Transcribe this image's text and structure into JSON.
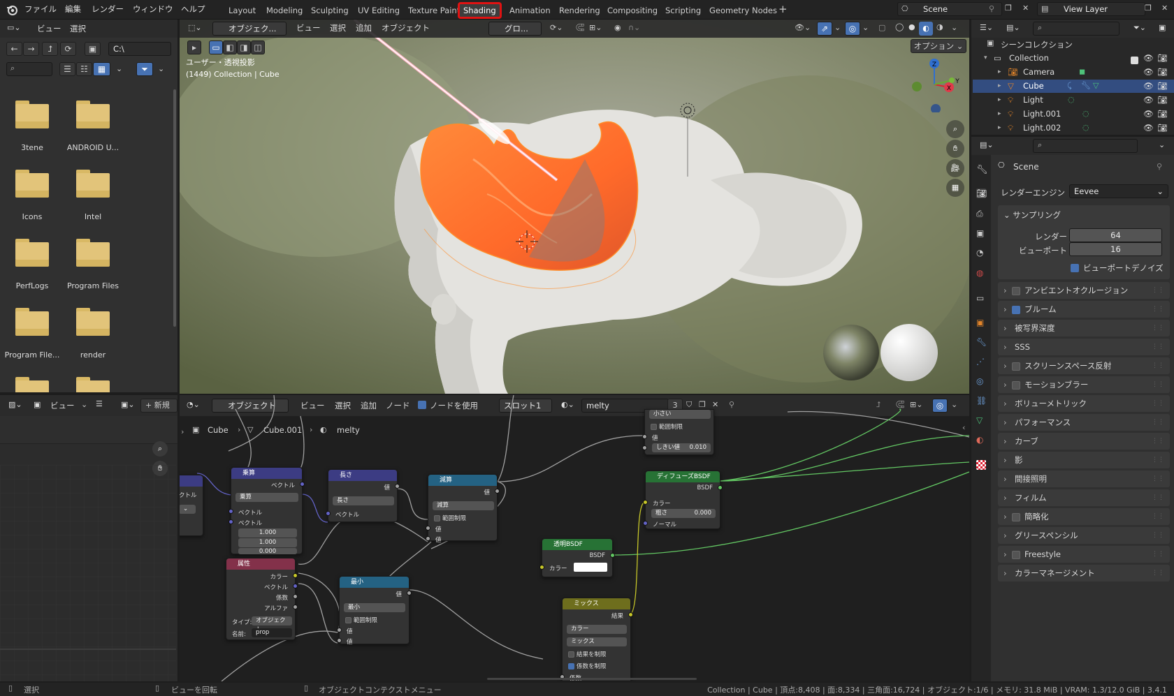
{
  "topbar": {
    "menus": [
      "ファイル",
      "編集",
      "レンダー",
      "ウィンドウ",
      "ヘルプ"
    ],
    "workspaces": [
      "Layout",
      "Modeling",
      "Sculpting",
      "UV Editing",
      "Texture Paint",
      "Shading",
      "Animation",
      "Rendering",
      "Compositing",
      "Scripting",
      "Geometry Nodes"
    ],
    "active_workspace": "Shading",
    "scene_name": "Scene",
    "view_layer": "View Layer"
  },
  "file_browser": {
    "header": {
      "view": "ビュー",
      "select": "選択"
    },
    "path": "C:\\",
    "folders": [
      "3tene",
      "ANDROID U...",
      "Icons",
      "Intel",
      "PerfLogs",
      "Program Files",
      "Program File...",
      "render"
    ]
  },
  "viewport": {
    "header": {
      "mode": "オブジェク...",
      "view": "ビュー",
      "select": "選択",
      "add": "追加",
      "object": "オブジェクト",
      "transform": "グロ..."
    },
    "options": "オプション",
    "info_line1": "ユーザー・透視投影",
    "info_line2": "(1449) Collection | Cube",
    "axis_x": "X",
    "axis_y": "Y",
    "axis_z": "Z"
  },
  "image_editor": {
    "view": "ビュー",
    "new": "新規"
  },
  "node_editor": {
    "header": {
      "mode": "オブジェクト",
      "view": "ビュー",
      "select": "選択",
      "add": "追加",
      "node": "ノード",
      "use_nodes": "ノードを使用",
      "slot": "スロット1",
      "material": "melty",
      "users": "3"
    },
    "breadcrumb": [
      "Cube",
      "Cube.001",
      "melty"
    ],
    "nodes": {
      "multiply": {
        "title": "乗算",
        "out": "ベクトル",
        "op": "乗算",
        "in1": "ベクトル",
        "in2": "ベクトル",
        "v1": "1.000",
        "v2": "1.000",
        "v3": "0.000"
      },
      "length": {
        "title": "長さ",
        "out": "値",
        "op": "長さ",
        "in1": "ベクトル"
      },
      "subtract": {
        "title": "減算",
        "out": "値",
        "op": "減算",
        "clamp": "範囲制限",
        "in1": "値",
        "in2": "値"
      },
      "attribute": {
        "title": "属性",
        "out1": "カラー",
        "out2": "ベクトル",
        "out3": "係数",
        "out4": "アルファ",
        "type_label": "タイプ:",
        "type_value": "オブジェクト",
        "name_label": "名前:",
        "name_value": "prop"
      },
      "minimum": {
        "title": "最小",
        "out": "値",
        "op": "最小",
        "clamp": "範囲制限",
        "in1": "値",
        "in2": "値"
      },
      "compare": {
        "op": "小さい",
        "clamp": "範囲制限",
        "out": "値",
        "thresh_label": "しきい値",
        "thresh_value": "0.010"
      },
      "diffuse": {
        "title": "ディフューズBSDF",
        "out": "BSDF",
        "in1": "カラー",
        "rough_label": "粗さ",
        "rough_value": "0.000",
        "in3": "ノーマル"
      },
      "transparent": {
        "title": "透明BSDF",
        "out": "BSDF",
        "in1": "カラー"
      },
      "mix": {
        "title": "ミックス",
        "out": "結果",
        "type": "カラー",
        "blend": "ミックス",
        "clamp_result": "結果を制限",
        "clamp_factor": "係数を制限",
        "fac": "係数"
      },
      "partial_left": {
        "label": "クトル"
      }
    }
  },
  "outliner": {
    "scene_collection": "シーンコレクション",
    "items": [
      {
        "name": "Collection",
        "level": 0
      },
      {
        "name": "Camera",
        "level": 1
      },
      {
        "name": "Cube",
        "level": 1,
        "selected": true
      },
      {
        "name": "Light",
        "level": 1
      },
      {
        "name": "Light.001",
        "level": 1
      },
      {
        "name": "Light.002",
        "level": 1
      }
    ]
  },
  "properties": {
    "scene_label": "Scene",
    "render_engine_label": "レンダーエンジン",
    "render_engine": "Eevee",
    "sampling": "サンプリング",
    "render_label": "レンダー",
    "render_value": "64",
    "viewport_label": "ビューポート",
    "viewport_value": "16",
    "viewport_denoise": "ビューポートデノイズ",
    "panels": [
      {
        "label": "アンビエントオクルージョン",
        "check": true,
        "on": false
      },
      {
        "label": "ブルーム",
        "check": true,
        "on": true
      },
      {
        "label": "被写界深度",
        "check": false
      },
      {
        "label": "SSS",
        "check": false
      },
      {
        "label": "スクリーンスペース反射",
        "check": true,
        "on": false
      },
      {
        "label": "モーションブラー",
        "check": true,
        "on": false
      },
      {
        "label": "ボリューメトリック",
        "check": false
      },
      {
        "label": "パフォーマンス",
        "check": false
      },
      {
        "label": "カーブ",
        "check": false
      },
      {
        "label": "影",
        "check": false
      },
      {
        "label": "間接照明",
        "check": false
      },
      {
        "label": "フィルム",
        "check": false
      },
      {
        "label": "簡略化",
        "check": true,
        "on": false
      },
      {
        "label": "グリースペンシル",
        "check": false
      },
      {
        "label": "Freestyle",
        "check": true,
        "on": false
      },
      {
        "label": "カラーマネージメント",
        "check": false
      }
    ]
  },
  "statusbar": {
    "select": "選択",
    "rotate": "ビューを回転",
    "context": "オブジェクトコンテクストメニュー",
    "stats": "Collection | Cube | 頂点:8,408 | 面:8,334 | 三角面:16,724 | オブジェクト:1/6 | メモリ: 31.8 MiB | VRAM: 1.3/12.0 GiB | 3.4.1"
  }
}
